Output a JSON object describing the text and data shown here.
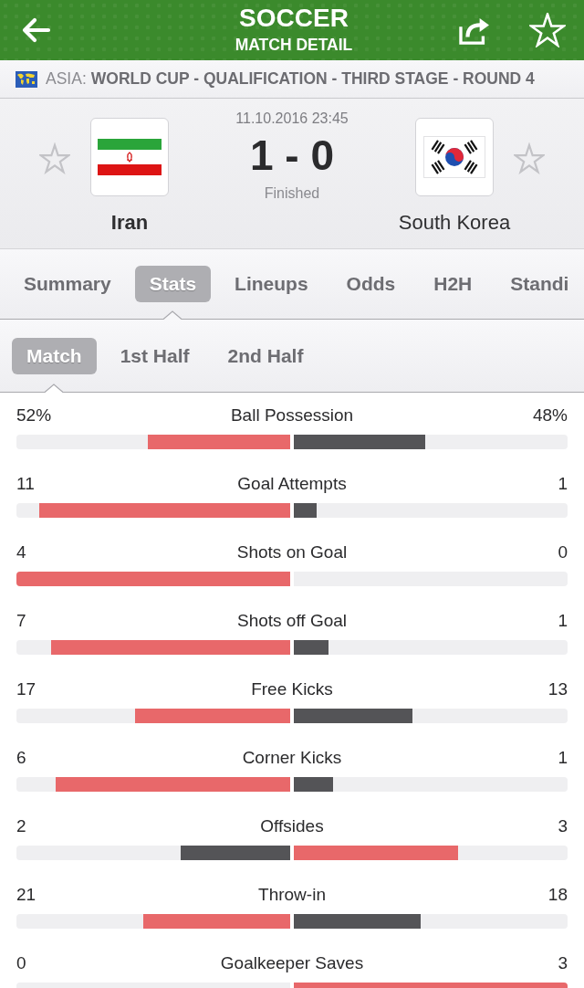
{
  "header": {
    "title": "SOCCER",
    "subtitle": "MATCH DETAIL",
    "favorite": false
  },
  "competition": {
    "region": "ASIA:",
    "name": "WORLD CUP - QUALIFICATION - THIRD STAGE - ROUND 4"
  },
  "match": {
    "date": "11.10.2016 23:45",
    "score": "1 - 0",
    "status": "Finished",
    "home": {
      "name": "Iran",
      "winner": true,
      "favorite": false
    },
    "away": {
      "name": "South Korea",
      "winner": false,
      "favorite": false
    }
  },
  "tabs": [
    {
      "label": "Summary",
      "selected": false
    },
    {
      "label": "Stats",
      "selected": true
    },
    {
      "label": "Lineups",
      "selected": false
    },
    {
      "label": "Odds",
      "selected": false
    },
    {
      "label": "H2H",
      "selected": false
    },
    {
      "label": "Standi",
      "selected": false
    }
  ],
  "periods": [
    {
      "label": "Match",
      "selected": true
    },
    {
      "label": "1st Half",
      "selected": false
    },
    {
      "label": "2nd Half",
      "selected": false
    }
  ],
  "stats": [
    {
      "label": "Ball Possession",
      "home": {
        "value": "52%",
        "level": 0.52
      },
      "away": {
        "value": "48%",
        "level": 0.48
      }
    },
    {
      "label": "Goal Attempts",
      "home": {
        "value": "11",
        "level": 0.917
      },
      "away": {
        "value": "1",
        "level": 0.083
      }
    },
    {
      "label": "Shots on Goal",
      "home": {
        "value": "4",
        "level": 1
      },
      "away": {
        "value": "0",
        "level": 0
      }
    },
    {
      "label": "Shots off Goal",
      "home": {
        "value": "7",
        "level": 0.875
      },
      "away": {
        "value": "1",
        "level": 0.125
      }
    },
    {
      "label": "Free Kicks",
      "home": {
        "value": "17",
        "level": 0.567
      },
      "away": {
        "value": "13",
        "level": 0.433
      }
    },
    {
      "label": "Corner Kicks",
      "home": {
        "value": "6",
        "level": 0.857
      },
      "away": {
        "value": "1",
        "level": 0.143
      }
    },
    {
      "label": "Offsides",
      "home": {
        "value": "2",
        "level": 0.4
      },
      "away": {
        "value": "3",
        "level": 0.6
      }
    },
    {
      "label": "Throw-in",
      "home": {
        "value": "21",
        "level": 0.538
      },
      "away": {
        "value": "18",
        "level": 0.462
      }
    },
    {
      "label": "Goalkeeper Saves",
      "home": {
        "value": "0",
        "level": 0
      },
      "away": {
        "value": "3",
        "level": 1
      }
    }
  ]
}
